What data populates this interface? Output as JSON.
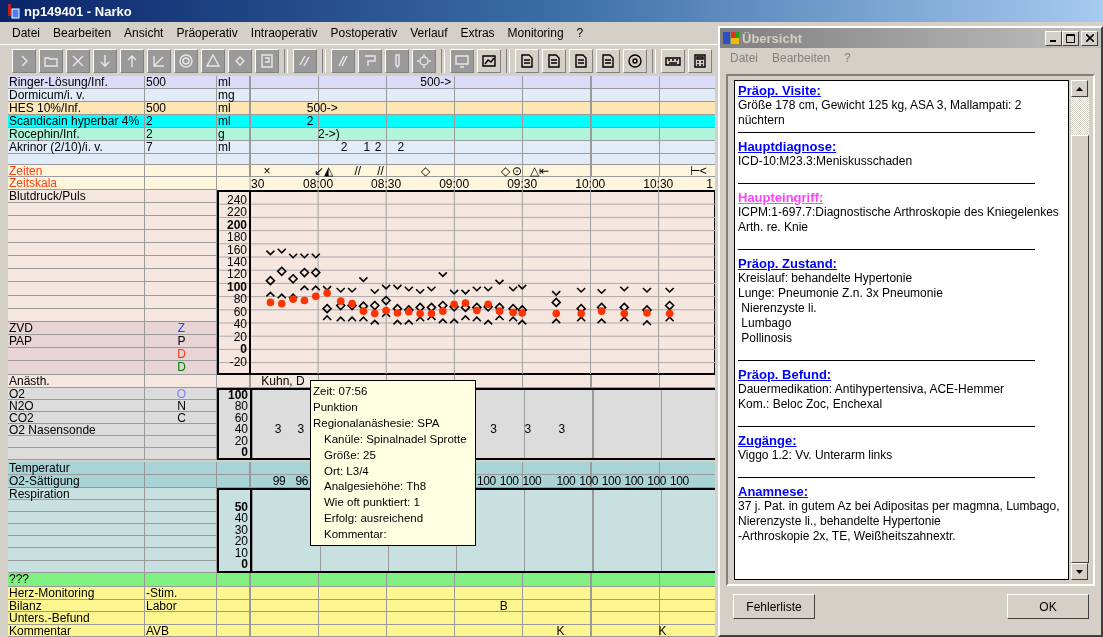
{
  "window": {
    "title": "np149401 - Narko"
  },
  "menu": [
    "Datei",
    "Bearbeiten",
    "Ansicht",
    "Präoperativ",
    "Intraoperativ",
    "Postoperativ",
    "Verlauf",
    "Extras",
    "Monitoring",
    "?"
  ],
  "toolbar": [
    [
      {
        "disabled": true
      },
      {
        "disabled": true
      },
      {
        "disabled": true
      },
      {
        "disabled": true
      },
      {
        "disabled": true
      },
      {
        "disabled": true
      },
      {
        "disabled": true
      },
      {
        "disabled": true
      },
      {
        "disabled": true
      },
      {
        "disabled": true
      }
    ],
    [
      {
        "disabled": true
      }
    ],
    [
      {
        "disabled": true
      },
      {
        "disabled": true
      },
      {
        "disabled": true
      },
      {
        "disabled": true
      }
    ],
    [
      {
        "disabled": true
      },
      {
        "disabled": false
      }
    ],
    [
      {
        "disabled": false
      },
      {
        "disabled": false
      },
      {
        "disabled": false
      },
      {
        "disabled": false
      },
      {
        "disabled": false
      }
    ],
    [
      {
        "disabled": false
      },
      {
        "disabled": false
      }
    ]
  ],
  "medications": [
    {
      "name": "Ringer-Lösung/Inf.",
      "amount": "500",
      "unit": "ml",
      "color": "#dcdcf8",
      "cells": [
        null,
        null,
        null,
        null,
        null,
        null,
        null,
        null,
        null,
        null,
        null,
        null,
        null,
        null,
        null,
        "500->"
      ]
    },
    {
      "name": "Dormicum/i. v.",
      "unit": "mg",
      "color": "#e2ecf8"
    },
    {
      "name": "HES 10%/Inf.",
      "amount": "500",
      "unit": "ml",
      "color": "#fde6b4",
      "cells": [
        null,
        null,
        null,
        null,
        null,
        "500->"
      ]
    },
    {
      "name": "Scandicain hyperbar 4%",
      "amount": "2",
      "unit": "ml",
      "color": "#00ffff",
      "cells": [
        null,
        null,
        null,
        null,
        null,
        "2"
      ]
    },
    {
      "name": "Rocephin/Inf.",
      "amount": "2",
      "unit": "g",
      "color": "#aef5dc",
      "cells": [
        null,
        null,
        null,
        null,
        null,
        null,
        "2->)"
      ]
    },
    {
      "name": "Akrinor (2/10)/i. v.",
      "amount": "7",
      "unit": "ml",
      "color": "#e2ecf8",
      "cells": [
        null,
        null,
        null,
        null,
        null,
        null,
        null,
        null,
        "2",
        null,
        "1",
        "2",
        null,
        "2"
      ]
    }
  ],
  "zeiten": {
    "label": "Zeiten",
    "cells": [
      null,
      "×",
      null,
      null,
      null,
      null,
      "↙◭",
      null,
      null,
      "//",
      null,
      "//",
      null,
      null,
      null,
      "◇",
      null,
      null,
      null,
      null,
      null,
      null,
      "◇",
      "⊙",
      null,
      "△⇤",
      null,
      null,
      null,
      null,
      null,
      null,
      null,
      null,
      null,
      null,
      null,
      null,
      null,
      "⊢<"
    ]
  },
  "vitals": {
    "scale_label": "Zeitskala",
    "cut_tick_labels": [
      "30",
      "1"
    ],
    "label": "Blutdruck/Puls",
    "rows": [
      {
        "label": "ZVD",
        "code": "Z",
        "color": "#2040ff"
      },
      {
        "label": "PAP",
        "code": "P"
      },
      {
        "code": "D",
        "color": "#ff3000"
      },
      {
        "code": "D",
        "color": "#008000"
      }
    ],
    "chart_data": {
      "type": "scatter",
      "grid": true,
      "xlim": [
        450,
        655
      ],
      "ylim": [
        -40,
        254
      ],
      "xticks": [
        {
          "value": 480,
          "label": "08:00"
        },
        {
          "value": 510,
          "label": "08:30"
        },
        {
          "value": 540,
          "label": "09:00"
        },
        {
          "value": 570,
          "label": "09:30"
        },
        {
          "value": 600,
          "label": "10:00"
        },
        {
          "value": 630,
          "label": "10:30"
        }
      ],
      "yticks": [
        240,
        220,
        200,
        180,
        160,
        140,
        120,
        100,
        80,
        60,
        40,
        20,
        0,
        -20
      ],
      "x": [
        459,
        464,
        469,
        474,
        479,
        484,
        490,
        495,
        500,
        505,
        510,
        515,
        520,
        525,
        530,
        535,
        540,
        545,
        550,
        555,
        560,
        566,
        570,
        585,
        596,
        605,
        615,
        625,
        635
      ],
      "series": [
        {
          "color": "#000000",
          "values": [
            155,
            158,
            150,
            150,
            150,
            98,
            95,
            95,
            112,
            93,
            100,
            100,
            97,
            93,
            97,
            120,
            92,
            92,
            97,
            97,
            108,
            97,
            100,
            90,
            95,
            93,
            97,
            95,
            95
          ]
        },
        {
          "color": "#000000",
          "values": [
            110,
            125,
            113,
            123,
            123,
            65,
            70,
            70,
            69,
            70,
            78,
            65,
            63,
            67,
            67,
            70,
            68,
            67,
            67,
            68,
            67,
            65,
            63,
            75,
            65,
            67,
            67,
            63,
            70
          ]
        },
        {
          "color": "#000000",
          "values": [
            88,
            85,
            85,
            98,
            98,
            50,
            48,
            48,
            48,
            43,
            55,
            43,
            43,
            48,
            50,
            45,
            45,
            50,
            48,
            43,
            50,
            48,
            43,
            45,
            48,
            45,
            48,
            42,
            48
          ]
        },
        {
          "color": "#ff3300",
          "values": [
            75,
            73,
            80,
            78,
            85,
            90,
            77,
            73,
            61,
            57,
            62,
            58,
            60,
            57,
            57,
            61,
            72,
            74,
            62,
            72,
            61,
            59,
            58,
            57,
            57,
            61,
            57,
            58,
            57
          ]
        }
      ]
    }
  },
  "anaesthesia": {
    "label": "Anästh.",
    "cells": [
      null,
      "Kuhn, D"
    ]
  },
  "gases": {
    "scale": [
      "100",
      "80",
      "60",
      "40",
      "20",
      "0"
    ],
    "rows": [
      {
        "label": "O2",
        "code": "O",
        "color": "#8080ff"
      },
      {
        "label": "N2O",
        "code": "N"
      },
      {
        "label": "CO2",
        "code": "C"
      },
      {
        "label": "O2 Nasensonde",
        "cells": [
          null,
          null,
          "3",
          null,
          "3",
          null,
          null,
          null,
          null,
          null,
          null,
          null,
          null,
          null,
          null,
          null,
          null,
          null,
          null,
          null,
          null,
          "3",
          null,
          null,
          "3",
          null,
          null,
          "3"
        ]
      }
    ]
  },
  "temperature": {
    "label": "Temperatur"
  },
  "saturation": {
    "label": "O2-Sättigung",
    "cells": [
      null,
      null,
      "99",
      null,
      "96",
      null,
      null,
      null,
      null,
      null,
      null,
      null,
      null,
      null,
      null,
      null,
      null,
      null,
      null,
      null,
      "100",
      null,
      "100",
      null,
      "100",
      null,
      null,
      "100",
      null,
      "100",
      null,
      "100",
      null,
      "100",
      null,
      "100",
      null,
      "100"
    ]
  },
  "respiration": {
    "label": "Respiration",
    "scale": [
      "50",
      "40",
      "30",
      "20",
      "10",
      "0"
    ]
  },
  "unknown_row": {
    "label": "???"
  },
  "footer_rows": [
    {
      "label": "Herz-Monitoring",
      "column_2": "-Stim."
    },
    {
      "label": "Bilanz",
      "column_2": "Labor",
      "cells": [
        null,
        null,
        null,
        null,
        null,
        null,
        null,
        null,
        null,
        null,
        null,
        null,
        null,
        null,
        null,
        null,
        null,
        null,
        null,
        null,
        null,
        null,
        "B"
      ]
    },
    {
      "label": "Unters.-Befund"
    },
    {
      "label": "Kommentar",
      "column_2": "AVB",
      "cells": [
        null,
        null,
        null,
        null,
        null,
        null,
        null,
        null,
        null,
        null,
        null,
        null,
        null,
        null,
        null,
        null,
        null,
        null,
        null,
        null,
        null,
        null,
        null,
        null,
        null,
        null,
        null,
        "K",
        null,
        null,
        null,
        null,
        null,
        null,
        null,
        null,
        "K"
      ]
    }
  ],
  "tooltip": {
    "lines": [
      "Zeit: 07:56",
      "Punktion",
      "Regionalanäshesie: SPA"
    ],
    "details": [
      "Kanüle: Spinalnadel Sprotte",
      "Größe: 25",
      "Ort: L3/4",
      "Analgesiehöhe: Th8",
      "Wie oft punktiert: 1",
      "Erfolg: ausreichend",
      "Kommentar:"
    ]
  },
  "overview": {
    "title": "Übersicht",
    "menu": [
      "Datei",
      "Bearbeiten",
      "?"
    ],
    "sections": [
      {
        "heading": "Präop. Visite:",
        "color": "#0000ff",
        "lines": [
          "Größe 178 cm, Gewicht 125 kg, ASA 3, Mallampati: 2",
          "nüchtern"
        ]
      },
      {
        "heading": "Hauptdiagnose:",
        "color": "#0000ff",
        "lines": [
          "ICD-10:M23.3:Meniskusschaden"
        ]
      },
      {
        "heading": "Haupteingriff:",
        "color": "#ff40ff",
        "lines": [
          "ICPM:1-697.7:Diagnostische Arthroskopie des Kniegelenkes",
          "Arth. re. Knie"
        ]
      },
      {
        "heading": "Präop. Zustand:",
        "color": "#0000ff",
        "lines": [
          "Kreislauf: behandelte Hypertonie",
          "Lunge: Pneumonie Z.n. 3x Pneumonie",
          " Nierenzyste li.",
          " Lumbago",
          " Pollinosis"
        ]
      },
      {
        "heading": "Präop. Befund:",
        "color": "#0000ff",
        "lines": [
          "Dauermedikation: Antihypertensiva, ACE-Hemmer",
          "Kom.: Beloc Zoc, Enchexal"
        ]
      },
      {
        "heading": "Zugänge:",
        "color": "#0000ff",
        "lines": [
          "Viggo 1.2: Vv. Unterarm links"
        ]
      },
      {
        "heading": "Anamnese:",
        "color": "#0000ff",
        "lines": [
          "37 j. Pat. in gutem Az bei Adipositas per magmna, Lumbago,",
          "Nierenzyste li., behandelte Hypertonie",
          "-Arthroskopie 2x, TE, Weißheitszahnextr."
        ]
      }
    ],
    "buttons": [
      "Fehlerliste",
      "OK"
    ]
  }
}
